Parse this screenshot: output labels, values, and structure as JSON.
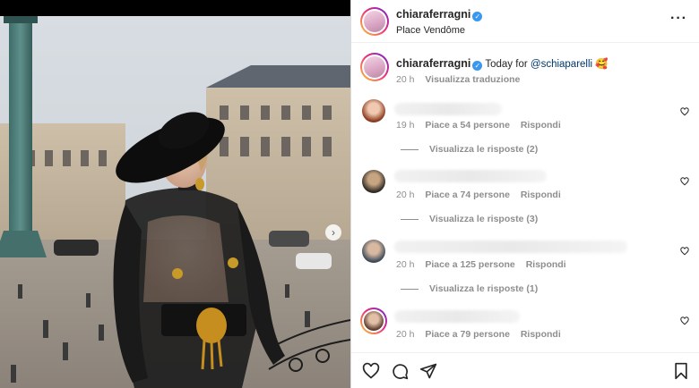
{
  "post": {
    "username": "chiaraferragni",
    "location": "Place Vendôme",
    "caption_text": "Today for",
    "caption_mention": "@schiaparelli",
    "caption_emoji": "🥰",
    "caption_time": "20 h",
    "translate_label": "Visualizza traduzione"
  },
  "comments": [
    {
      "time": "19 h",
      "likes": "Piace a 54 persone",
      "reply": "Rispondi",
      "view_replies": "Visualizza le risposte (2)"
    },
    {
      "time": "20 h",
      "likes": "Piace a 74 persone",
      "reply": "Rispondi",
      "view_replies": "Visualizza le risposte (3)"
    },
    {
      "time": "20 h",
      "likes": "Piace a 125 persone",
      "reply": "Rispondi",
      "view_replies": "Visualizza le risposte (1)"
    },
    {
      "time": "20 h",
      "likes": "Piace a 79 persone",
      "reply": "Rispondi"
    }
  ],
  "icons": {
    "more": "more-options-icon",
    "like": "heart-icon",
    "comment": "comment-icon",
    "share": "share-icon",
    "save": "bookmark-icon",
    "next": "chevron-right-icon"
  },
  "colors": {
    "verified": "#3897f0",
    "secondary_text": "#8e8e8e",
    "primary_text": "#262626",
    "story_ring_start": "#f9ce34",
    "story_ring_end": "#6228d7"
  }
}
